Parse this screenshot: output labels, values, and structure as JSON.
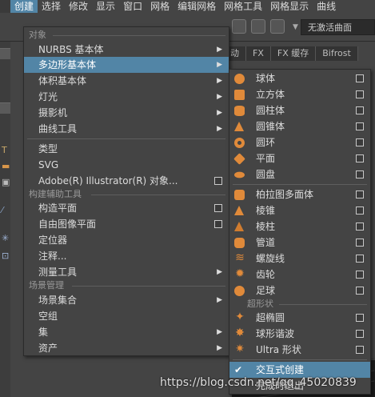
{
  "menubar": [
    {
      "label": "创建",
      "active": true
    },
    {
      "label": "选择"
    },
    {
      "label": "修改"
    },
    {
      "label": "显示"
    },
    {
      "label": "窗口"
    },
    {
      "label": "网格"
    },
    {
      "label": "编辑网格"
    },
    {
      "label": "网格工具"
    },
    {
      "label": "网格显示"
    },
    {
      "label": "曲线"
    }
  ],
  "toolbar": {
    "field_value": "无激活曲面",
    "tabs": [
      "动",
      "FX",
      "FX 缓存",
      "Bifrost"
    ]
  },
  "menu1": {
    "sections": {
      "object": "对象",
      "construction": "构建辅助工具",
      "scene": "场景管理"
    },
    "items": [
      {
        "label": "NURBS 基本体",
        "submenu": true
      },
      {
        "label": "多边形基本体",
        "submenu": true,
        "highlighted": true
      },
      {
        "label": "体积基本体",
        "submenu": true
      },
      {
        "label": "灯光",
        "submenu": true
      },
      {
        "label": "摄影机",
        "submenu": true
      },
      {
        "label": "曲线工具",
        "submenu": true
      },
      {
        "label": "类型"
      },
      {
        "label": "SVG"
      },
      {
        "label": "Adobe(R) Illustrator(R) 对象...",
        "option": true
      },
      {
        "label": "构造平面",
        "option": true
      },
      {
        "label": "自由图像平面",
        "option": true
      },
      {
        "label": "定位器"
      },
      {
        "label": "注释..."
      },
      {
        "label": "测量工具",
        "submenu": true
      },
      {
        "label": "场景集合",
        "submenu": true
      },
      {
        "label": "空组"
      },
      {
        "label": "集",
        "submenu": true
      },
      {
        "label": "资产",
        "submenu": true
      }
    ]
  },
  "menu2": {
    "section_superquadric": "超形状",
    "items": [
      {
        "label": "球体",
        "icon": "sphere-icon"
      },
      {
        "label": "立方体",
        "icon": "cube-icon"
      },
      {
        "label": "圆柱体",
        "icon": "cylinder-icon"
      },
      {
        "label": "圆锥体",
        "icon": "cone-icon"
      },
      {
        "label": "圆环",
        "icon": "torus-icon"
      },
      {
        "label": "平面",
        "icon": "plane-icon"
      },
      {
        "label": "圆盘",
        "icon": "disc-icon"
      },
      {
        "label": "柏拉图多面体",
        "icon": "platonic-icon"
      },
      {
        "label": "棱锥",
        "icon": "pyramid-icon"
      },
      {
        "label": "棱柱",
        "icon": "prism-icon"
      },
      {
        "label": "管道",
        "icon": "pipe-icon"
      },
      {
        "label": "螺旋线",
        "icon": "helix-icon"
      },
      {
        "label": "齿轮",
        "icon": "gear-icon"
      },
      {
        "label": "足球",
        "icon": "soccer-ball-icon"
      },
      {
        "label": "超椭圆",
        "icon": "super-ellipse-icon"
      },
      {
        "label": "球形谐波",
        "icon": "spherical-harmonics-icon"
      },
      {
        "label": "Ultra 形状",
        "icon": "ultra-shapes-icon"
      },
      {
        "label": "交互式创建",
        "checked": true
      },
      {
        "label": "完成时退出"
      }
    ]
  },
  "watermark": "https://blog.csdn.net/qq_45020839"
}
